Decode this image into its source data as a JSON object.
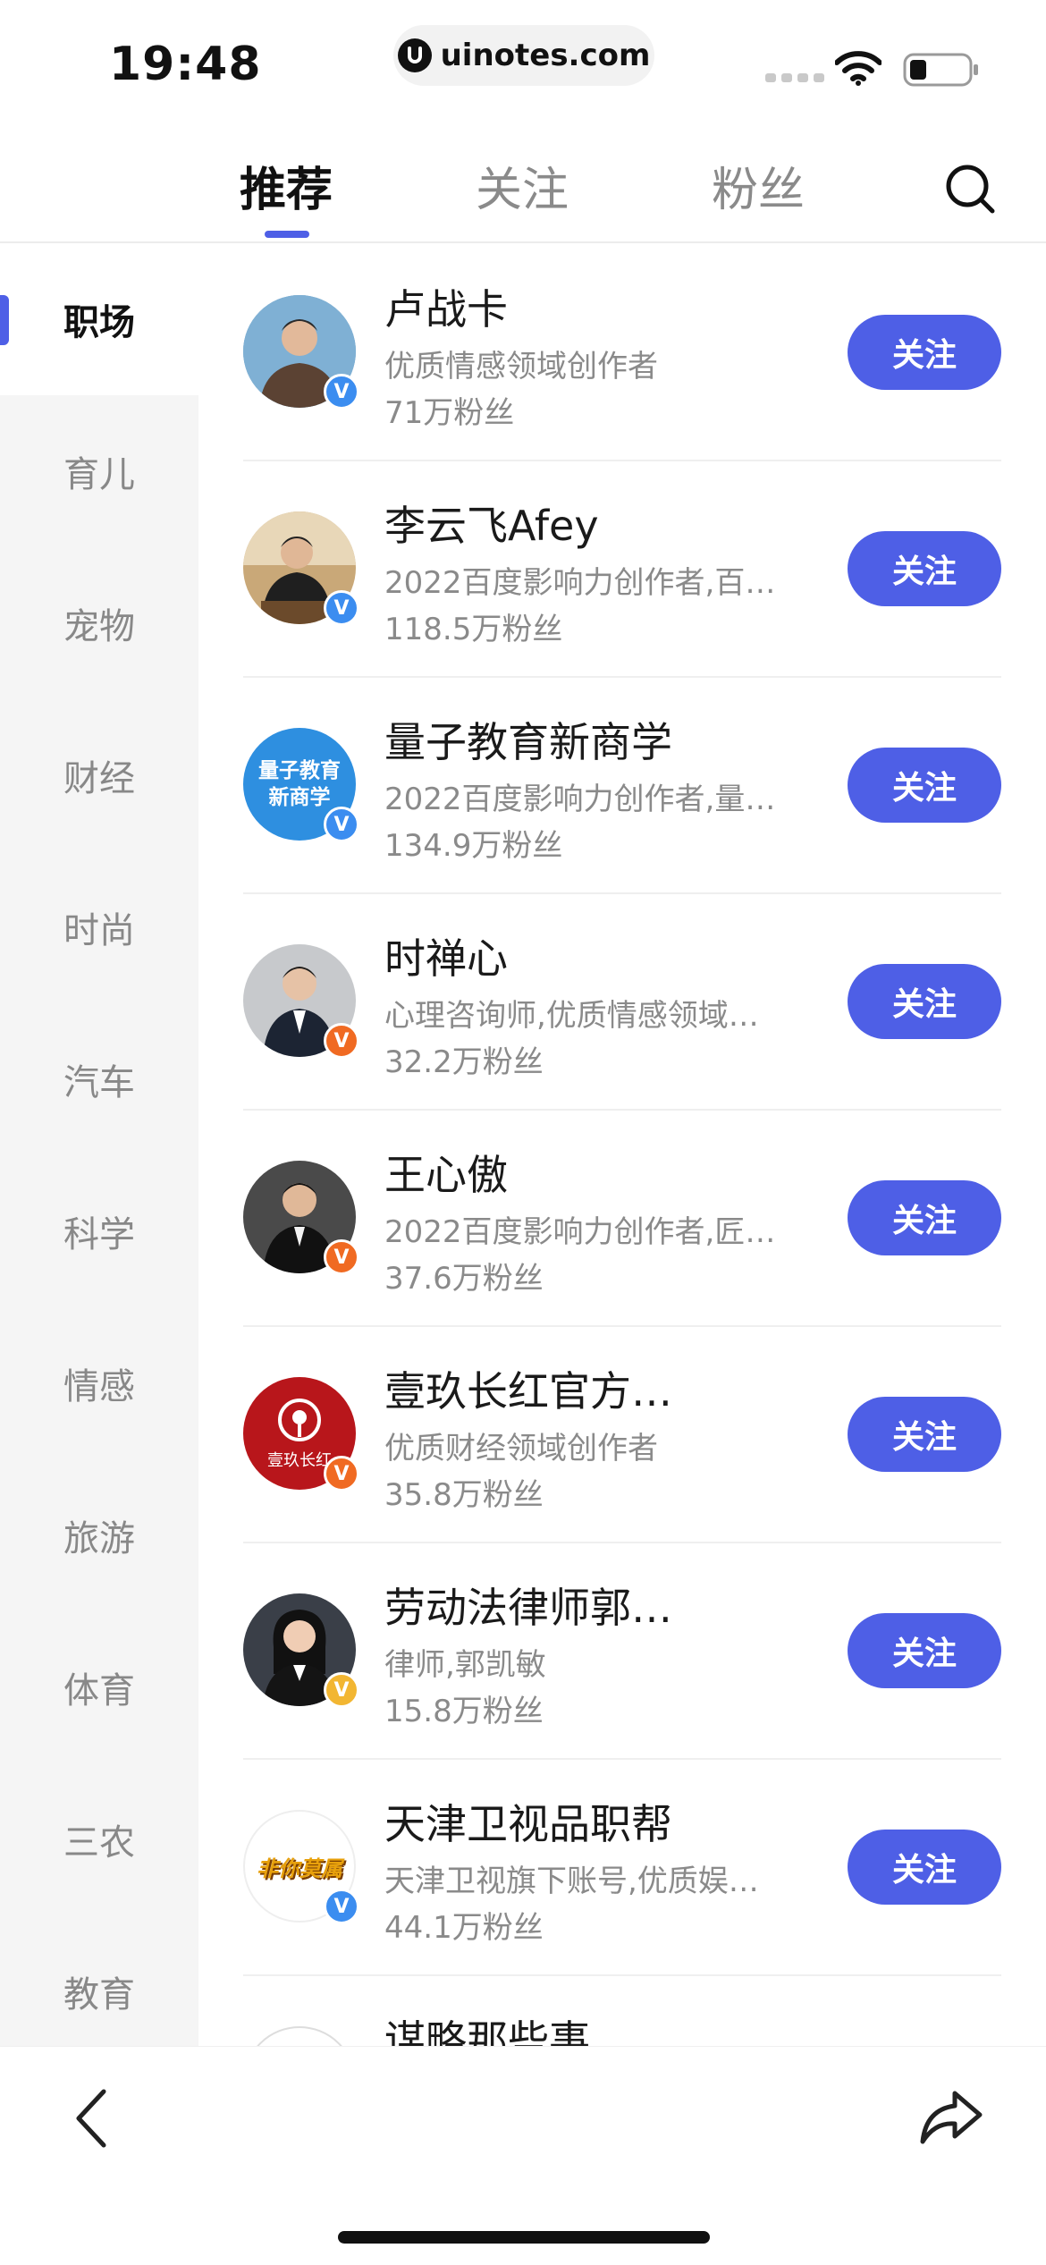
{
  "status_bar": {
    "time": "19:48",
    "url": "uinotes.com"
  },
  "tabs": [
    {
      "label": "推荐",
      "active": true
    },
    {
      "label": "关注",
      "active": false
    },
    {
      "label": "粉丝",
      "active": false
    }
  ],
  "sidebar": {
    "items": [
      "职场",
      "育儿",
      "宠物",
      "财经",
      "时尚",
      "汽车",
      "科学",
      "情感",
      "旅游",
      "体育",
      "三农",
      "教育"
    ],
    "active_index": 0
  },
  "list": {
    "follow_label": "关注",
    "items": [
      {
        "name": "卢战卡",
        "desc": "优质情感领域创作者",
        "fans": "71万粉丝",
        "badge_color": "#3b8df0"
      },
      {
        "name": "李云飞Afey",
        "desc": "2022百度影响力创作者,百…",
        "fans": "118.5万粉丝",
        "badge_color": "#3b8df0"
      },
      {
        "name": "量子教育新商学",
        "desc": "2022百度影响力创作者,量…",
        "fans": "134.9万粉丝",
        "badge_color": "#3b8df0",
        "avatar_text": [
          "量子教育",
          "新商学"
        ]
      },
      {
        "name": "时禅心",
        "desc": "心理咨询师,优质情感领域…",
        "fans": "32.2万粉丝",
        "badge_color": "#f06a22"
      },
      {
        "name": "王心傲",
        "desc": "2022百度影响力创作者,匠…",
        "fans": "37.6万粉丝",
        "badge_color": "#f06a22"
      },
      {
        "name": "壹玖长红官方…",
        "desc": "优质财经领域创作者",
        "fans": "35.8万粉丝",
        "badge_color": "#f06a22",
        "avatar_text": [
          "壹玖长红"
        ]
      },
      {
        "name": "劳动法律师郭…",
        "desc": "律师,郭凯敏",
        "fans": "15.8万粉丝",
        "badge_color": "#f2b632"
      },
      {
        "name": "天津卫视品职帮",
        "desc": "天津卫视旗下账号,优质娱…",
        "fans": "44.1万粉丝",
        "badge_color": "#3b8df0",
        "avatar_text": [
          "非你莫属"
        ]
      },
      {
        "name": "谋略那些事",
        "desc": "",
        "fans": "",
        "badge_color": "#3b8df0"
      }
    ]
  },
  "colors": {
    "accent": "#4e5fe6",
    "sidebar_bg": "#f5f5f5",
    "muted_text": "#8a8a8a"
  },
  "icons": {
    "search": "search-icon",
    "back": "chevron-left-icon",
    "share": "share-icon",
    "wifi": "wifi-icon",
    "battery": "battery-icon"
  }
}
